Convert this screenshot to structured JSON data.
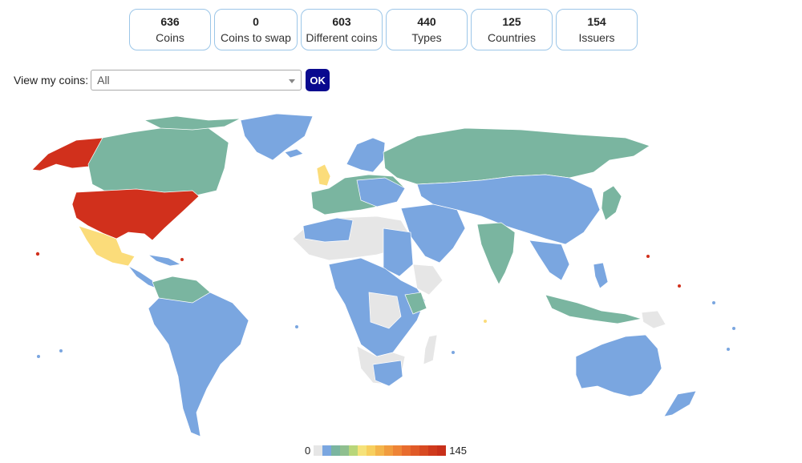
{
  "stats": [
    {
      "value": "636",
      "label": "Coins"
    },
    {
      "value": "0",
      "label": "Coins to swap"
    },
    {
      "value": "603",
      "label": "Different coins"
    },
    {
      "value": "440",
      "label": "Types"
    },
    {
      "value": "125",
      "label": "Countries"
    },
    {
      "value": "154",
      "label": "Issuers"
    }
  ],
  "filter": {
    "label": "View my coins:",
    "selected": "All",
    "ok": "OK"
  },
  "legend": {
    "min": "0",
    "max": "145",
    "colors": [
      "#e6e6e6",
      "#7aa6e0",
      "#7ab5a0",
      "#8fbf8f",
      "#b8d67a",
      "#f5e27a",
      "#f7cf5e",
      "#f4b54b",
      "#f19c3e",
      "#ee8436",
      "#e86c2e",
      "#e05a28",
      "#d84a22",
      "#cf3a1d",
      "#c8301a"
    ]
  },
  "colors": {
    "none": "#e6e6e6",
    "blue": "#7aa6e0",
    "green": "#7ab5a0",
    "yellow": "#fbdc7a",
    "red": "#d1301c"
  }
}
